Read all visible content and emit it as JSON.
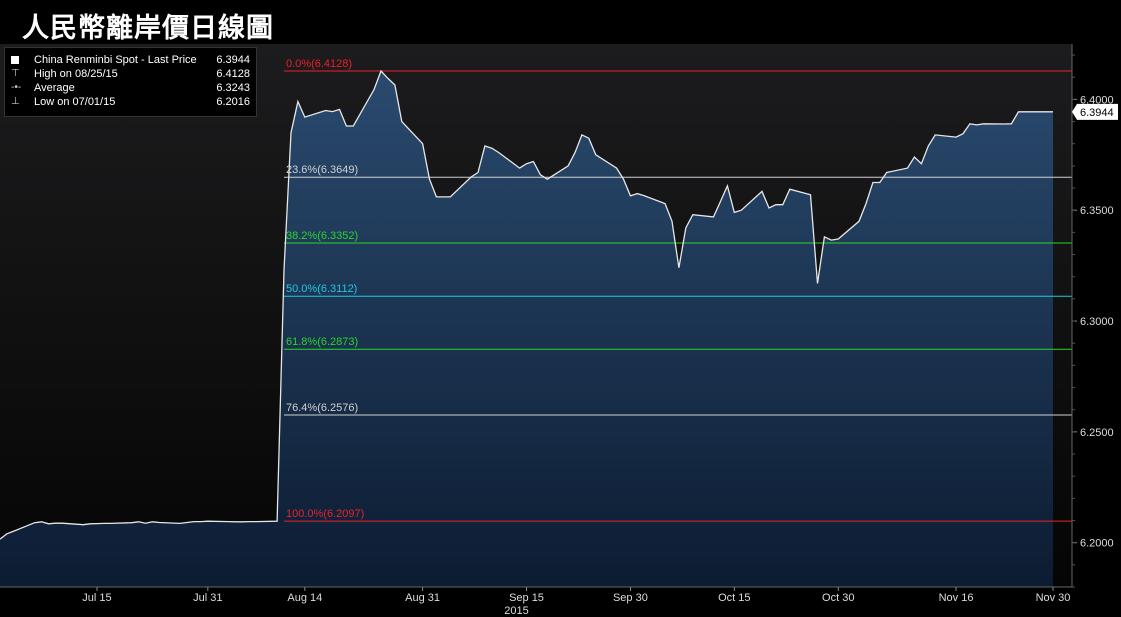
{
  "title": "人民幣離岸價日線圖",
  "legend": {
    "items": [
      {
        "symbol": "■",
        "label": "China Renminbi Spot - Last Price",
        "value": "6.3944"
      },
      {
        "symbol": "⊤",
        "label": "High on 08/25/15",
        "value": "6.4128"
      },
      {
        "symbol": "-•-",
        "label": "Average",
        "value": "6.3243"
      },
      {
        "symbol": "⊥",
        "label": "Low on 07/01/15",
        "value": "6.2016"
      }
    ]
  },
  "colors": {
    "background": "#000000",
    "plot_background_top": "#1c1c1e",
    "plot_background_bottom": "#050505",
    "area_fill_top": "#2a4a6e",
    "area_fill_bottom": "#0c1c32",
    "line": "#e6e6e6"
  },
  "chart_data": {
    "type": "area",
    "title": "人民幣離岸價日線圖",
    "xlabel": "2015",
    "ylabel": "",
    "ylim": [
      6.18,
      6.425
    ],
    "y_ticks": [
      "6.2000",
      "6.2500",
      "6.3000",
      "6.3500",
      "6.4000"
    ],
    "x_ticks": [
      "Jul 15",
      "Jul 31",
      "Aug 14",
      "Aug 31",
      "Sep 15",
      "Sep 30",
      "Oct 15",
      "Oct 30",
      "Nov 16",
      "Nov 30"
    ],
    "x_year_label": "2015",
    "last_price_label": "6.3944",
    "fibonacci_levels": [
      {
        "label": "0.0%(6.4128)",
        "value": 6.4128,
        "color": "#e8202a"
      },
      {
        "label": "23.6%(6.3649)",
        "value": 6.3649,
        "color": "#d0d0d0"
      },
      {
        "label": "38.2%(6.3352)",
        "value": 6.3352,
        "color": "#2bd42b"
      },
      {
        "label": "50.0%(6.3112)",
        "value": 6.3112,
        "color": "#22c8e0"
      },
      {
        "label": "61.8%(6.2873)",
        "value": 6.2873,
        "color": "#2bd42b"
      },
      {
        "label": "76.4%(6.2576)",
        "value": 6.2576,
        "color": "#d0d0d0"
      },
      {
        "label": "100.0%(6.2097)",
        "value": 6.2097,
        "color": "#e8202a"
      }
    ],
    "series": [
      {
        "name": "China Renminbi Spot - Last Price",
        "x": [
          "07/01/15",
          "07/02/15",
          "07/03/15",
          "07/06/15",
          "07/07/15",
          "07/08/15",
          "07/09/15",
          "07/10/15",
          "07/13/15",
          "07/14/15",
          "07/15/15",
          "07/16/15",
          "07/17/15",
          "07/20/15",
          "07/21/15",
          "07/22/15",
          "07/23/15",
          "07/24/15",
          "07/27/15",
          "07/28/15",
          "07/29/15",
          "07/30/15",
          "07/31/15",
          "08/03/15",
          "08/04/15",
          "08/05/15",
          "08/06/15",
          "08/07/15",
          "08/10/15",
          "08/11/15",
          "08/12/15",
          "08/13/15",
          "08/14/15",
          "08/17/15",
          "08/18/15",
          "08/19/15",
          "08/20/15",
          "08/21/15",
          "08/24/15",
          "08/25/15",
          "08/26/15",
          "08/27/15",
          "08/28/15",
          "08/31/15",
          "09/01/15",
          "09/02/15",
          "09/03/15",
          "09/04/15",
          "09/07/15",
          "09/08/15",
          "09/09/15",
          "09/10/15",
          "09/11/15",
          "09/14/15",
          "09/15/15",
          "09/16/15",
          "09/17/15",
          "09/18/15",
          "09/21/15",
          "09/22/15",
          "09/23/15",
          "09/24/15",
          "09/25/15",
          "09/28/15",
          "09/29/15",
          "09/30/15",
          "10/01/15",
          "10/02/15",
          "10/05/15",
          "10/06/15",
          "10/07/15",
          "10/08/15",
          "10/09/15",
          "10/12/15",
          "10/13/15",
          "10/14/15",
          "10/15/15",
          "10/16/15",
          "10/19/15",
          "10/20/15",
          "10/21/15",
          "10/22/15",
          "10/23/15",
          "10/26/15",
          "10/27/15",
          "10/28/15",
          "10/29/15",
          "10/30/15",
          "11/02/15",
          "11/03/15",
          "11/04/15",
          "11/05/15",
          "11/06/15",
          "11/09/15",
          "11/10/15",
          "11/11/15",
          "11/12/15",
          "11/13/15",
          "11/16/15",
          "11/17/15",
          "11/18/15",
          "11/19/15",
          "11/20/15",
          "11/23/15",
          "11/24/15",
          "11/25/15",
          "11/26/15",
          "11/27/15",
          "11/30/15"
        ],
        "values": [
          6.2016,
          6.204,
          6.2052,
          6.209,
          6.2094,
          6.2085,
          6.2088,
          6.2088,
          6.2081,
          6.2085,
          6.2086,
          6.2087,
          6.2087,
          6.209,
          6.2094,
          6.2088,
          6.2094,
          6.2091,
          6.2087,
          6.2091,
          6.2095,
          6.2095,
          6.2097,
          6.2095,
          6.2094,
          6.2094,
          6.2095,
          6.2095,
          6.2097,
          6.323,
          6.385,
          6.399,
          6.392,
          6.395,
          6.3945,
          6.3955,
          6.388,
          6.388,
          6.4045,
          6.4128,
          6.4095,
          6.4065,
          6.39,
          6.38,
          6.364,
          6.356,
          6.356,
          6.356,
          6.365,
          6.367,
          6.379,
          6.378,
          6.376,
          6.369,
          6.371,
          6.372,
          6.366,
          6.364,
          6.37,
          6.376,
          6.384,
          6.3825,
          6.375,
          6.369,
          6.364,
          6.3565,
          6.3575,
          6.3565,
          6.353,
          6.345,
          6.324,
          6.342,
          6.348,
          6.347,
          6.354,
          6.361,
          6.349,
          6.35,
          6.3585,
          6.351,
          6.3525,
          6.3525,
          6.3595,
          6.357,
          6.317,
          6.338,
          6.3365,
          6.337,
          6.345,
          6.353,
          6.3625,
          6.3625,
          6.367,
          6.369,
          6.374,
          6.371,
          6.379,
          6.384,
          6.383,
          6.3845,
          6.389,
          6.3885,
          6.389,
          6.3889,
          6.389,
          6.3944,
          6.3944,
          6.3944,
          6.3944
        ]
      }
    ],
    "grid": false,
    "legend_position": "top-left"
  }
}
